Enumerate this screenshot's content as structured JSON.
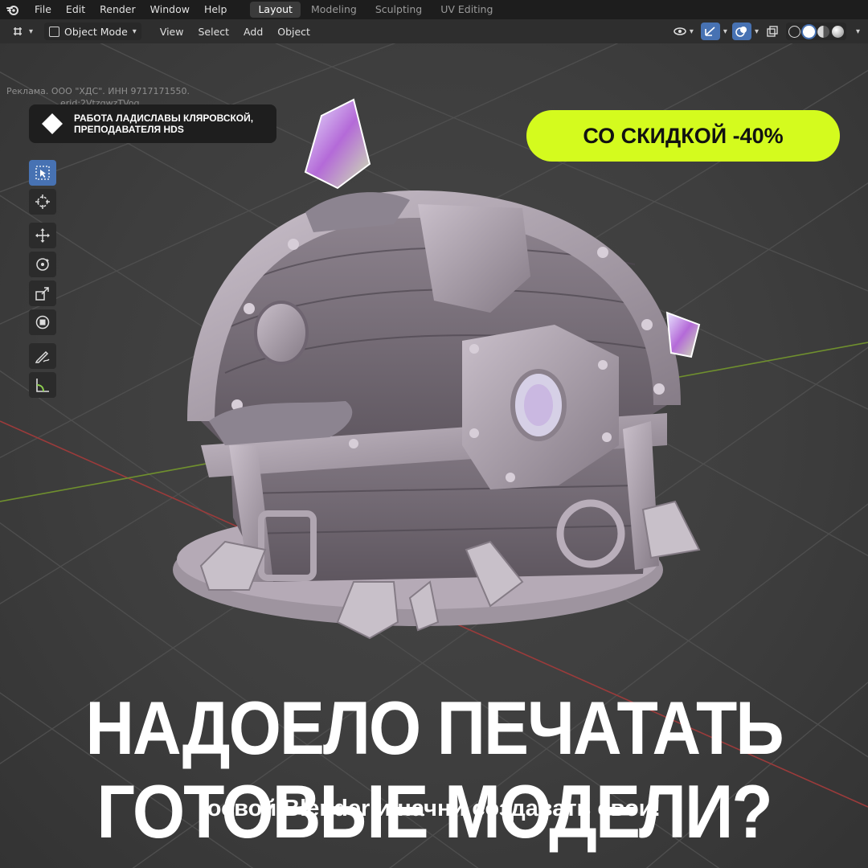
{
  "menubar": {
    "items": [
      "File",
      "Edit",
      "Render",
      "Window",
      "Help"
    ],
    "workspace_tabs": [
      {
        "label": "Layout",
        "active": true
      },
      {
        "label": "Modeling",
        "active": false
      },
      {
        "label": "Sculpting",
        "active": false
      },
      {
        "label": "UV Editing",
        "active": false
      }
    ]
  },
  "viewport_header": {
    "mode": "Object Mode",
    "menus": [
      "View",
      "Select",
      "Add",
      "Object"
    ]
  },
  "ad": {
    "disclaimer": "Реклама. ООО \"ХДС\". ИНН 9717171550.",
    "erid": "erid:2VtzqwzTVog"
  },
  "author_badge": {
    "line1": "РАБОТА ЛАДИСЛАВЫ КЛЯРОВСКОЙ,",
    "line2": "ПРЕПОДАВАТЕЛЯ HDS"
  },
  "discount": "СО СКИДКОЙ -40%",
  "headline": {
    "line1": "НАДОЕЛО ПЕЧАТАТЬ",
    "line2": "ГОТОВЫЕ МОДЕЛИ?"
  },
  "subline": "освой Blender и начни создавать свои!",
  "colors": {
    "accent_lime": "#d4fb1e",
    "blender_blue": "#4772b3",
    "axis_red": "#9b3b3b",
    "axis_green": "#6f8f2e"
  },
  "icons": [
    "blender-logo",
    "editor-type-icon",
    "object-mode-icon",
    "visibility-icon",
    "gizmo-icon",
    "overlay-icon",
    "xray-icon",
    "shading-wireframe-icon",
    "shading-solid-icon",
    "shading-material-icon",
    "shading-rendered-icon",
    "select-box-icon",
    "cursor-icon",
    "move-icon",
    "rotate-icon",
    "scale-icon",
    "transform-icon",
    "annotate-icon",
    "measure-icon",
    "diamond-icon"
  ]
}
